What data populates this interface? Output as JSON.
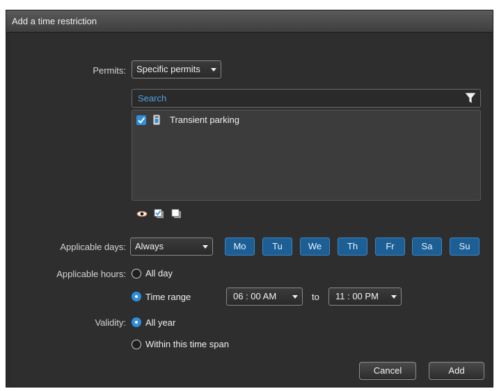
{
  "window": {
    "title": "Add a time restriction"
  },
  "permits": {
    "label": "Permits:",
    "selected": "Specific permits",
    "search_placeholder": "Search",
    "items": [
      {
        "label": "Transient parking",
        "checked": true,
        "icon": "permit-icon"
      }
    ],
    "tools": [
      "eye-icon",
      "check-all-icon",
      "uncheck-all-icon"
    ]
  },
  "applicable_days": {
    "label": "Applicable days:",
    "selected": "Always",
    "days": [
      "Mo",
      "Tu",
      "We",
      "Th",
      "Fr",
      "Sa",
      "Su"
    ]
  },
  "applicable_hours": {
    "label": "Applicable hours:",
    "all_day": "All day",
    "time_range": "Time range",
    "selected": "time_range",
    "from": "06 : 00 AM",
    "to_label": "to",
    "to": "11 : 00 PM"
  },
  "validity": {
    "label": "Validity:",
    "all_year": "All year",
    "span": "Within this time span",
    "selected": "all_year"
  },
  "buttons": {
    "cancel": "Cancel",
    "add": "Add"
  },
  "colors": {
    "accent": "#2f8fdc",
    "day_button": "#1d5f94",
    "background": "#2e2e2e",
    "search_text": "#4fa3e0"
  }
}
